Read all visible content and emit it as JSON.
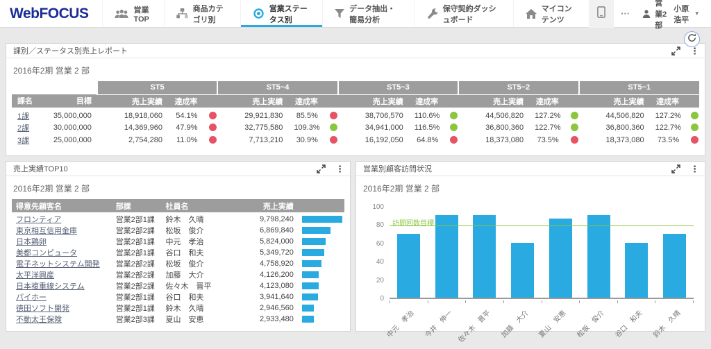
{
  "brand": "WebFOCUS",
  "nav": {
    "items": [
      {
        "label": "営業TOP",
        "icon": "people-icon",
        "active": false
      },
      {
        "label": "商品カテゴリ別",
        "icon": "sitemap-icon",
        "active": false
      },
      {
        "label": "営業ステータス別",
        "icon": "eye-icon",
        "active": true
      },
      {
        "label": "データ抽出・簡易分析",
        "icon": "filter-icon",
        "active": false
      },
      {
        "label": "保守契約ダッシュボード",
        "icon": "wrench-icon",
        "active": false
      },
      {
        "label": "マイコンテンツ",
        "icon": "home-icon",
        "active": false
      }
    ],
    "more_label": "···",
    "user": {
      "department": "営業2部",
      "name": "小原 浩平",
      "caret": "▾"
    }
  },
  "icons": {
    "kebab": "⋮"
  },
  "report_panel": {
    "title": "課別／ステータス別売上レポート",
    "subtitle": "2016年2期 営業 2 部",
    "groups": [
      "ST5",
      "ST5~4",
      "ST5~3",
      "ST5~2",
      "ST5~1"
    ],
    "col_headers": {
      "section": "課名",
      "target": "目標",
      "sales": "売上実績",
      "rate": "達成率"
    },
    "rows": [
      {
        "name": "1課",
        "target": "35,000,000",
        "cells": [
          {
            "sales": "18,918,060",
            "rate": "54.1%",
            "status": "red"
          },
          {
            "sales": "29,921,830",
            "rate": "85.5%",
            "status": "red"
          },
          {
            "sales": "38,706,570",
            "rate": "110.6%",
            "status": "green"
          },
          {
            "sales": "44,506,820",
            "rate": "127.2%",
            "status": "green"
          },
          {
            "sales": "44,506,820",
            "rate": "127.2%",
            "status": "green"
          }
        ]
      },
      {
        "name": "2課",
        "target": "30,000,000",
        "cells": [
          {
            "sales": "14,369,960",
            "rate": "47.9%",
            "status": "red"
          },
          {
            "sales": "32,775,580",
            "rate": "109.3%",
            "status": "green"
          },
          {
            "sales": "34,941,000",
            "rate": "116.5%",
            "status": "green"
          },
          {
            "sales": "36,800,360",
            "rate": "122.7%",
            "status": "green"
          },
          {
            "sales": "36,800,360",
            "rate": "122.7%",
            "status": "green"
          }
        ]
      },
      {
        "name": "3課",
        "target": "25,000,000",
        "cells": [
          {
            "sales": "2,754,280",
            "rate": "11.0%",
            "status": "red"
          },
          {
            "sales": "7,713,210",
            "rate": "30.9%",
            "status": "red"
          },
          {
            "sales": "16,192,050",
            "rate": "64.8%",
            "status": "red"
          },
          {
            "sales": "18,373,080",
            "rate": "73.5%",
            "status": "red"
          },
          {
            "sales": "18,373,080",
            "rate": "73.5%",
            "status": "red"
          }
        ]
      }
    ]
  },
  "top10_panel": {
    "title": "売上実績TOP10",
    "subtitle": "2016年2期 営業 2 部",
    "headers": [
      "得意先顧客名",
      "部課",
      "社員名",
      "売上実績"
    ],
    "rows": [
      {
        "customer": "フロンティア",
        "dept": "営業2部1課",
        "employee": "鈴木　久晴",
        "sales": "9,798,240",
        "value": 9798240
      },
      {
        "customer": "東京相互信用金庫",
        "dept": "営業2部2課",
        "employee": "松坂　俊介",
        "sales": "6,869,840",
        "value": 6869840
      },
      {
        "customer": "日本鶏卵",
        "dept": "営業2部1課",
        "employee": "中元　孝治",
        "sales": "5,824,000",
        "value": 5824000
      },
      {
        "customer": "美都コンピュータ",
        "dept": "営業2部1課",
        "employee": "谷口　和夫",
        "sales": "5,349,720",
        "value": 5349720
      },
      {
        "customer": "電子ネットシステム開発",
        "dept": "営業2部2課",
        "employee": "松坂　俊介",
        "sales": "4,758,920",
        "value": 4758920
      },
      {
        "customer": "太平洋興産",
        "dept": "営業2部2課",
        "employee": "加藤　大介",
        "sales": "4,126,200",
        "value": 4126200
      },
      {
        "customer": "日本複重線システム",
        "dept": "営業2部2課",
        "employee": "佐々木　晋平",
        "sales": "4,123,080",
        "value": 4123080
      },
      {
        "customer": "パイホー",
        "dept": "営業2部1課",
        "employee": "谷口　和夫",
        "sales": "3,941,640",
        "value": 3941640
      },
      {
        "customer": "徳田ソフト開発",
        "dept": "営業2部1課",
        "employee": "鈴木　久晴",
        "sales": "2,946,560",
        "value": 2946560
      },
      {
        "customer": "不動太王保険",
        "dept": "営業2部3課",
        "employee": "夏山　安恵",
        "sales": "2,933,480",
        "value": 2933480
      }
    ]
  },
  "visits_panel": {
    "title": "営業別顧客訪問状況",
    "subtitle": "2016年2期 営業 2 部",
    "chart_data": {
      "type": "bar",
      "categories": [
        "中元　孝治",
        "今井　伸一",
        "佐々木　晋平",
        "加藤　大介",
        "夏山　安恵",
        "松坂　俊介",
        "谷口　和夫",
        "鈴木　久晴"
      ],
      "values": [
        70,
        90,
        90,
        60,
        86,
        90,
        60,
        70
      ],
      "ylim": [
        0,
        100
      ],
      "yticks": [
        0,
        20,
        40,
        60,
        80,
        100
      ],
      "target_line": {
        "value": 80,
        "label": "訪問回数目標"
      },
      "grid": false,
      "legend": false,
      "xlabel": "",
      "ylabel": ""
    }
  },
  "colors": {
    "accent_blue": "#29abe2",
    "bar_blue": "#29abe2",
    "status_red": "#e65364",
    "status_green": "#8cc63f",
    "target_line_green": "#8cc63f",
    "table_header_gray": "#9d9d9d",
    "brand_blue": "#1b2d96"
  }
}
